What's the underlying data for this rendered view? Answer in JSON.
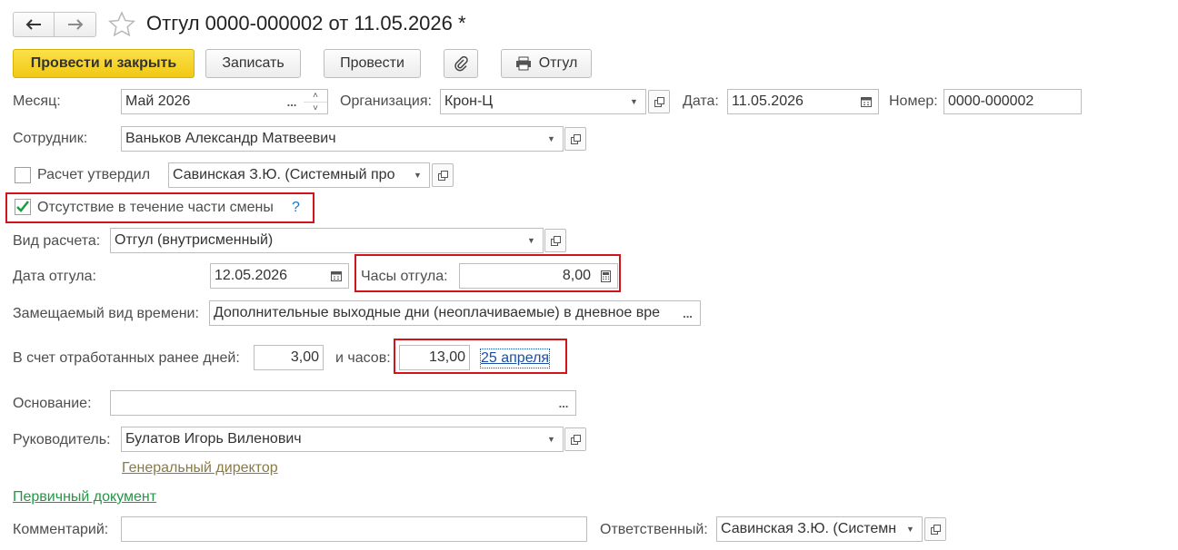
{
  "header": {
    "title": "Отгул 0000-000002 от 11.05.2026 *"
  },
  "toolbar": {
    "post_close": "Провести и закрыть",
    "save": "Записать",
    "post": "Провести",
    "print": "Отгул"
  },
  "fields": {
    "month_label": "Месяц:",
    "month_value": "Май 2026",
    "org_label": "Организация:",
    "org_value": "Крон-Ц",
    "date_label": "Дата:",
    "date_value": "11.05.2026",
    "number_label": "Номер:",
    "number_value": "0000-000002",
    "employee_label": "Сотрудник:",
    "employee_value": "Ваньков Александр Матвеевич",
    "approved_label": "Расчет утвердил",
    "approved_value": "Савинская З.Ю. (Системный про",
    "partial_label": "Отсутствие в течение части смены",
    "help": "?",
    "calc_type_label": "Вид расчета:",
    "calc_type_value": "Отгул (внутрисменный)",
    "leave_date_label": "Дата отгула:",
    "leave_date_value": "12.05.2026",
    "hours_label": "Часы отгула:",
    "hours_value": "8,00",
    "time_type_label": "Замещаемый вид времени:",
    "time_type_value": "Дополнительные выходные дни (неоплачиваемые) в дневное вре",
    "worked_days_label": "В счет отработанных ранее дней:",
    "worked_days_value": "3,00",
    "worked_hours_label": "и часов:",
    "worked_hours_value": "13,00",
    "worked_date_link": "25 апреля",
    "basis_label": "Основание:",
    "basis_value": "",
    "manager_label": "Руководитель:",
    "manager_value": "Булатов Игорь Виленович",
    "manager_position": "Генеральный директор",
    "primary_doc_link": "Первичный документ",
    "comment_label": "Комментарий:",
    "comment_value": "",
    "responsible_label": "Ответственный:",
    "responsible_value": "Савинская З.Ю. (Системн"
  },
  "icons": {
    "more": "...",
    "spin_up": "˄",
    "spin_down": "˅"
  },
  "colors": {
    "primary_button": "#f5d11f",
    "highlight": "#d3141b",
    "link_blue": "#1b4fa6",
    "link_green": "#1f9a43",
    "link_olive": "#8a7a45"
  }
}
